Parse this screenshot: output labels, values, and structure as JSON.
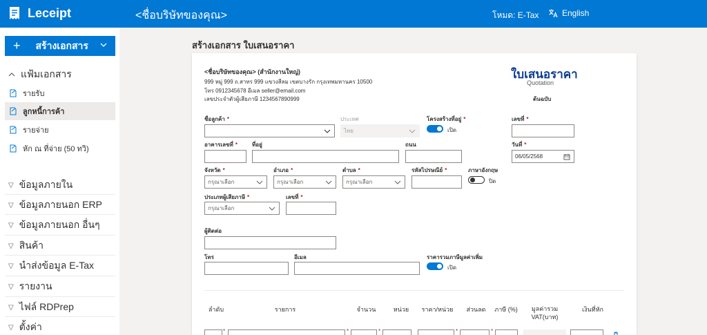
{
  "header": {
    "app_name": "Leceipt",
    "company": "<ชื่อบริษัทของคุณ>",
    "mode": "โหมด: E-Tax",
    "language": "English"
  },
  "sidebar": {
    "create_label": "สร้างเอกสาร",
    "folder_label": "แฟ้มเอกสาร",
    "sub_items": [
      {
        "label": "รายรับ"
      },
      {
        "label": "ลูกหนี้การค้า"
      },
      {
        "label": "รายจ่าย"
      },
      {
        "label": "หัก ณ ที่จ่าย (50 ทวิ)"
      }
    ],
    "groups": [
      {
        "label": "ข้อมูลภายใน"
      },
      {
        "label": "ข้อมูลภายนอก ERP"
      },
      {
        "label": "ข้อมูลภายนอก อื่นๆ"
      },
      {
        "label": "สินค้า"
      },
      {
        "label": "นำส่งข้อมูล E-Tax"
      },
      {
        "label": "รายงาน"
      },
      {
        "label": "ไฟล์ RDPrep"
      },
      {
        "label": "ตั้งค่า"
      }
    ]
  },
  "page": {
    "heading": "สร้างเอกสาร ใบเสนอราคา"
  },
  "seller": {
    "name": "<ชื่อบริษัทของคุณ> (สำนักงานใหญ่)",
    "address": "999 หมู่ 999 ถ.สาทร 999 แขวงสีลม เขตบางรัก กรุงเทพมหานคร 10500",
    "contact": "โทร 0912345678 อีเมล seller@email.com",
    "tax_id": "เลขประจำตัวผู้เสียภาษี 1234567890999"
  },
  "doc": {
    "title": "ใบเสนอราคา",
    "subtitle": "Quotation",
    "copy": "ต้นฉบับ"
  },
  "form": {
    "customer_name": "ชื่อลูกค้า",
    "country": "ประเทศ",
    "country_value": "ไทย",
    "structured_address": "โครงสร้างที่อยู่",
    "toggle_on": "เปิด",
    "toggle_off": "ปิด",
    "doc_number": "เลขที่",
    "building": "อาคารเลขที่",
    "address": "ที่อยู่",
    "road": "ถนน",
    "date": "วันที่",
    "date_value": "06/05/2568",
    "province": "จังหวัด",
    "district": "อำเภอ",
    "subdistrict": "ตำบล",
    "postcode": "รหัสไปรษณีย์",
    "english": "ภาษาอังกฤษ",
    "placeholder": "กรุณาเลือก",
    "taxpayer_type": "ประเภทผู้เสียภาษี",
    "tax_number": "เลขที่",
    "contact_person": "ผู้ติดต่อ",
    "phone": "โทร",
    "email": "อีเมล",
    "vat_included": "ราคารวมภาษีมูลค่าเพิ่ม"
  },
  "table": {
    "headers": [
      "ลำดับ",
      "รายการ",
      "จำนวน",
      "หน่วย",
      "ราคา/หน่วย",
      "ส่วนลด",
      "ภาษี (%)",
      "มูลค่ารวม VAT(บาท)",
      "เงินที่หัก"
    ]
  },
  "colors": {
    "primary": "#0078d4",
    "doc_title": "#0b3d91",
    "required": "#a4262c"
  }
}
